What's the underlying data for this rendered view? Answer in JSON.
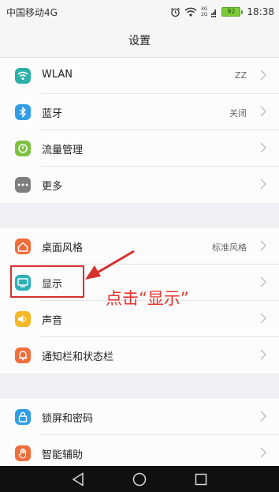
{
  "status_bar": {
    "carrier": "中国移动4G",
    "network_top": "4G",
    "network_bottom": "2G",
    "battery": "92",
    "time": "18:38"
  },
  "title": "设置",
  "groups": [
    {
      "items": [
        {
          "label": "WLAN",
          "value": "ZZ",
          "icon": "wifi-icon",
          "color": "#2bb0a6"
        },
        {
          "label": "蓝牙",
          "value": "关闭",
          "icon": "bluetooth-icon",
          "color": "#2f9ee6"
        },
        {
          "label": "流量管理",
          "value": "",
          "icon": "data-usage-icon",
          "color": "#7cc240"
        },
        {
          "label": "更多",
          "value": "",
          "icon": "more-icon",
          "color": "#7d7d7d"
        }
      ]
    },
    {
      "items": [
        {
          "label": "桌面风格",
          "value": "标准风格",
          "icon": "home-icon",
          "color": "#f06d3c"
        },
        {
          "label": "显示",
          "value": "",
          "icon": "display-icon",
          "color": "#2bb0b8"
        },
        {
          "label": "声音",
          "value": "",
          "icon": "sound-icon",
          "color": "#f4b826"
        },
        {
          "label": "通知栏和状态栏",
          "value": "",
          "icon": "notification-icon",
          "color": "#f06d3c"
        }
      ]
    },
    {
      "items": [
        {
          "label": "锁屏和密码",
          "value": "",
          "icon": "lock-icon",
          "color": "#2f9ee6"
        },
        {
          "label": "智能辅助",
          "value": "",
          "icon": "hand-icon",
          "color": "#f06d3c"
        }
      ]
    }
  ],
  "annotation": {
    "text": "点击“显示”",
    "color": "#e8342f"
  },
  "colors": {
    "background": "#efeff4",
    "nav_bar": "#101010",
    "highlight": "#d5322e"
  }
}
